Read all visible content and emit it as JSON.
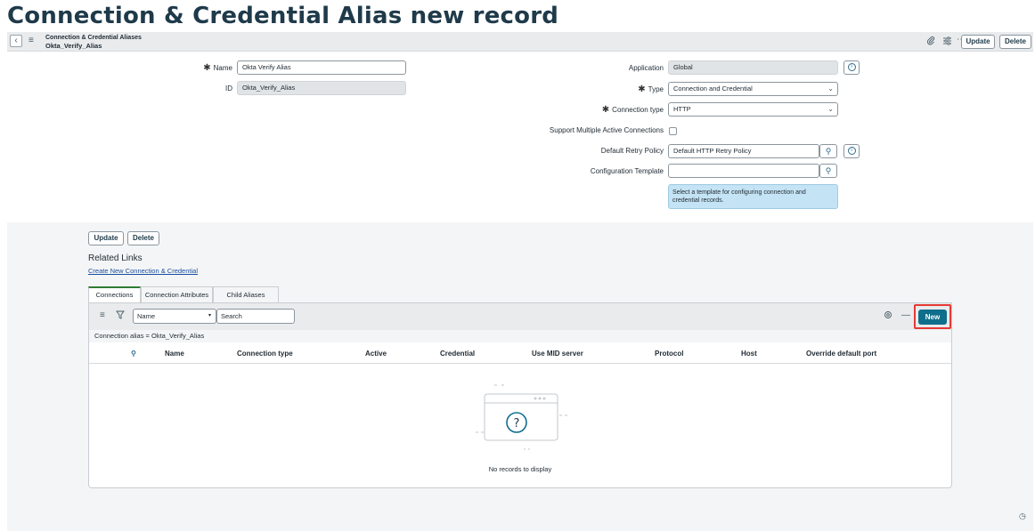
{
  "page": {
    "heading": "Connection & Credential Alias new record"
  },
  "header": {
    "breadcrumb_table": "Connection & Credential Aliases",
    "record_name": "Okta_Verify_Alias",
    "update_label": "Update",
    "delete_label": "Delete",
    "icons": [
      "back-icon",
      "hamburger-menu-icon",
      "paperclip-icon",
      "settings-sliders-icon",
      "more-options-icon"
    ]
  },
  "form": {
    "name": {
      "label": "Name",
      "value": "Okta Verify Alias",
      "required": true
    },
    "id": {
      "label": "ID",
      "value": "Okta_Verify_Alias"
    },
    "application": {
      "label": "Application",
      "value": "Global"
    },
    "type": {
      "label": "Type",
      "value": "Connection and Credential",
      "required": true
    },
    "connection_type": {
      "label": "Connection type",
      "value": "HTTP",
      "required": true
    },
    "multiple_active": {
      "label": "Support Multiple Active Connections",
      "checked": false
    },
    "retry_policy": {
      "label": "Default Retry Policy",
      "value": "Default HTTP Retry Policy"
    },
    "config_template": {
      "label": "Configuration Template",
      "value": "",
      "hint": "Select a template for configuring connection and credential records."
    }
  },
  "bottom_actions": {
    "update_label": "Update",
    "delete_label": "Delete"
  },
  "related_links": {
    "title": "Related Links",
    "link": "Create New Connection & Credential"
  },
  "tabs": [
    {
      "label": "Connections",
      "active": true
    },
    {
      "label": "Connection Attributes",
      "active": false
    },
    {
      "label": "Child Aliases",
      "active": false
    }
  ],
  "list": {
    "search_field": "Name",
    "search_placeholder": "Search",
    "new_label": "New",
    "filter_text": "Connection alias = Okta_Verify_Alias",
    "columns": [
      "Name",
      "Connection type",
      "Active",
      "Credential",
      "Use MID server",
      "Protocol",
      "Host",
      "Override default port"
    ],
    "empty_text": "No records to display"
  },
  "colors": {
    "accent": "#0f6e8c",
    "highlight": "#e53935",
    "hint_bg": "#c4e3f4"
  }
}
